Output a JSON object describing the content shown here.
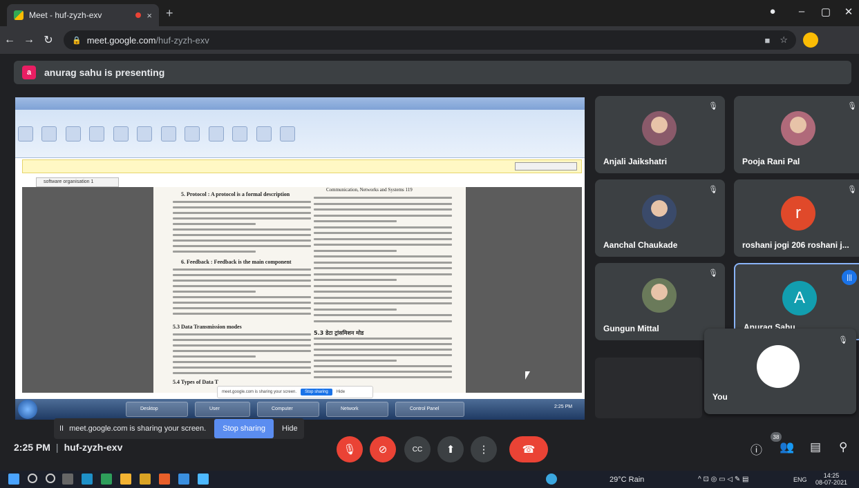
{
  "browser": {
    "tab_title": "Meet - huf-zyzh-exv",
    "tab_close": "×",
    "new_tab": "+",
    "url_host": "meet.google.com",
    "url_path": "/huf-zyzh-exv"
  },
  "presenting": {
    "avatar_letter": "a",
    "text": "anurag sahu is presenting"
  },
  "shared_screen": {
    "doc_tab": "software organisation 1",
    "heading_protocol": "5. Protocol : A protocol is a formal description",
    "heading_feedback": "6. Feedback : Feedback is the main component",
    "heading_data": "5.3 Data Transmission modes",
    "heading_types": "5.4 Types of Data T",
    "header_right": "Communication, Networks and Systems 119",
    "heading_hindi": "5.3 डेटा ट्रांसमिशन मोड",
    "share_notice": "meet.google.com is sharing your screen.",
    "share_stop": "Stop sharing",
    "share_hide": "Hide",
    "taskbar_items": [
      "Desktop",
      "User",
      "Computer",
      "Network",
      "Control Panel"
    ],
    "taskbar_time": "2:25 PM"
  },
  "participants": [
    {
      "name": "Anjali Jaikshatri",
      "kind": "photo",
      "color": "#8a5a6a"
    },
    {
      "name": "Pooja Rani Pal",
      "kind": "photo",
      "color": "#b06a7a"
    },
    {
      "name": "Aanchal Chaukade",
      "kind": "photo",
      "color": "#3a4a6a"
    },
    {
      "name": "roshani jogi 206 roshani j...",
      "kind": "letter",
      "letter": "r",
      "color": "#e0492a"
    },
    {
      "name": "Gungun Mittal",
      "kind": "photo",
      "color": "#6a7a5a"
    },
    {
      "name": "Anurag Sahu",
      "kind": "letter",
      "letter": "A",
      "color": "#129eaf"
    }
  ],
  "self_view": {
    "name": "You"
  },
  "share_bar": {
    "text": "meet.google.com is sharing your screen.",
    "stop": "Stop sharing",
    "hide": "Hide"
  },
  "meeting": {
    "time": "2:25 PM",
    "code": "huf-zyzh-exv",
    "participant_count": "38"
  },
  "taskbar": {
    "weather": "29°C Rain",
    "lang": "ENG",
    "time": "14:25",
    "date": "08-07-2021"
  },
  "colors": {
    "meet_bg": "#202124",
    "tile_bg": "#3c4043",
    "danger": "#ea4335",
    "accent": "#1a73e8"
  }
}
